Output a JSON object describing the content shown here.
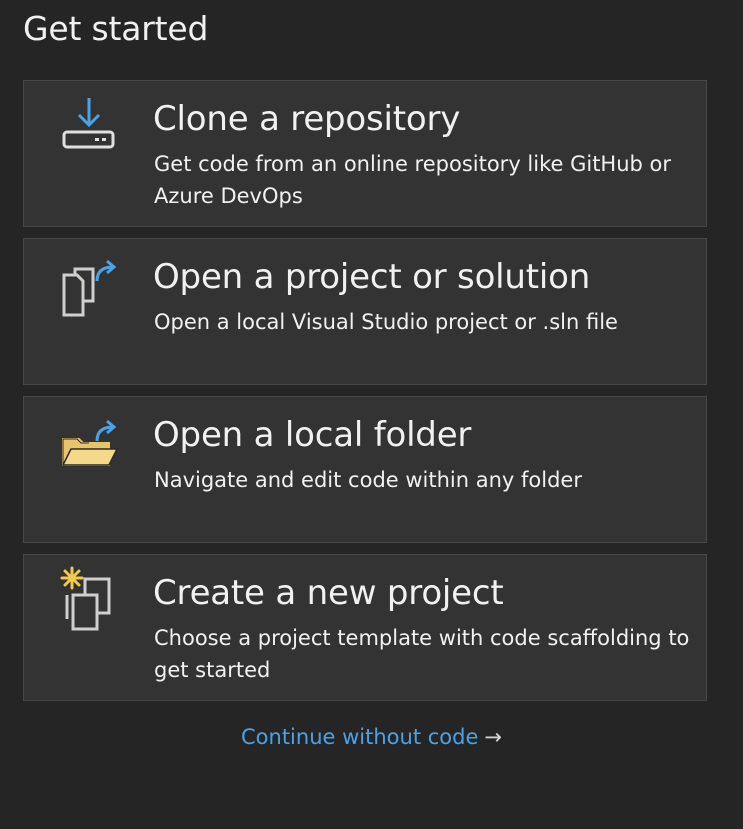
{
  "heading": "Get started",
  "cards": [
    {
      "title": "Clone a repository",
      "description": "Get code from an online repository like GitHub or Azure DevOps",
      "icon": "clone-repository-icon"
    },
    {
      "title": "Open a project or solution",
      "description": "Open a local Visual Studio project or .sln file",
      "icon": "open-project-icon"
    },
    {
      "title": "Open a local folder",
      "description": "Navigate and edit code within any folder",
      "icon": "open-folder-icon"
    },
    {
      "title": "Create a new project",
      "description": "Choose a project template with code scaffolding to get started",
      "icon": "new-project-icon"
    }
  ],
  "continue_link": {
    "label": "Continue without code",
    "arrow": "→"
  },
  "colors": {
    "background": "#252526",
    "card": "#333333",
    "card_border": "#484848",
    "text": "#f1f1f1",
    "link": "#4aa3e8",
    "accent_blue": "#4aa3e8",
    "folder_yellow": "#e8c46a",
    "spark_yellow": "#f2c94c"
  }
}
